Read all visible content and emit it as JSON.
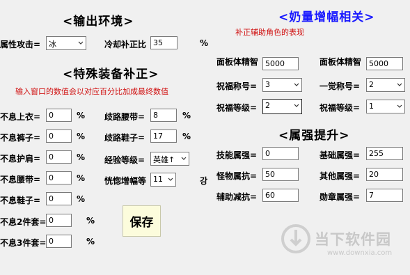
{
  "sections": {
    "output_env": "<输出环境>",
    "special_gear": "<特殊装备补正>",
    "buff_related": "<奶量增幅相关>",
    "element_boost": "<属强提升>"
  },
  "notes": {
    "buff_note": "补正辅助角色的表现",
    "gear_note": "输入窗口的数值会以对应百分比加成最终数值"
  },
  "output_env": {
    "element_label": "属性攻击=",
    "element_value": "冰",
    "cooldown_label": "冷却补正比",
    "cooldown_value": "35",
    "cooldown_unit": "%"
  },
  "gear": {
    "left": [
      {
        "label": "不息上衣=",
        "value": "0",
        "unit": "%"
      },
      {
        "label": "不息裤子=",
        "value": "0",
        "unit": "%"
      },
      {
        "label": "不息护肩=",
        "value": "0",
        "unit": "%"
      },
      {
        "label": "不息腰带=",
        "value": "0",
        "unit": "%"
      },
      {
        "label": "不息鞋子=",
        "value": "0",
        "unit": "%"
      },
      {
        "label": "不息2件套=",
        "value": "0",
        "unit": "%"
      },
      {
        "label": "不息3件套=",
        "value": "0",
        "unit": "%"
      }
    ],
    "belt_label": "歧路腰带=",
    "belt_value": "8",
    "belt_unit": "%",
    "shoes_label": "歧路鞋子=",
    "shoes_value": "17",
    "shoes_unit": "%",
    "exp_label": "经验等级=",
    "exp_value": "英雄↑",
    "daze_label": "恍惚增幅等",
    "daze_value": "11",
    "daze_suffix": "강",
    "save_label": "保存"
  },
  "buff": {
    "panel_left_label": "面板体精智",
    "panel_left_value": "5000",
    "panel_right_label": "面板体精智",
    "panel_right_value": "5000",
    "bless_title_label": "祝福称号=",
    "bless_title_value": "3",
    "awaken_title_label": "一觉称号=",
    "awaken_title_value": "2",
    "bless_level_label": "祝福等级=",
    "bless_level_value": "2",
    "bless_level2_label": "祝福等级=",
    "bless_level2_value": "1"
  },
  "element": {
    "skill_label": "技能属强=",
    "skill_value": "0",
    "base_label": "基础属强=",
    "base_value": "255",
    "monster_label": "怪物属抗=",
    "monster_value": "50",
    "other_label": "其他属强=",
    "other_value": "20",
    "support_label": "辅助减抗=",
    "support_value": "60",
    "badge_label": "勋章属强=",
    "badge_value": "7"
  },
  "watermark": {
    "text": "当下软件园",
    "url": "www.downxia.com"
  },
  "colors": {
    "title_blue": "#1a1aff",
    "note_red": "#d01010",
    "save_bg": "#fcfcdc",
    "window_bg": "#f0f0f0"
  }
}
